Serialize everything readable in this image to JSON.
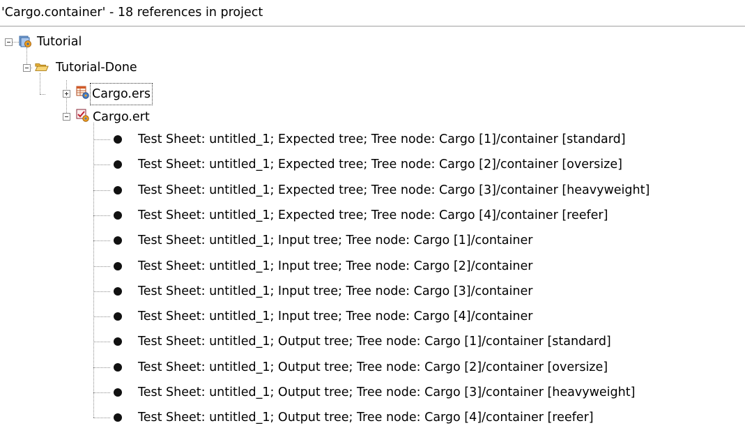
{
  "header": {
    "title": "'Cargo.container' - 18 references in project"
  },
  "tree": {
    "root": {
      "label": "Tutorial",
      "icon": "project-icon",
      "state": "expanded"
    },
    "folder": {
      "label": "Tutorial-Done",
      "icon": "open-folder-icon",
      "state": "expanded"
    },
    "files": [
      {
        "label": "Cargo.ers",
        "icon": "ers-file-icon",
        "state": "collapsed",
        "selected": true
      },
      {
        "label": "Cargo.ert",
        "icon": "ert-file-icon",
        "state": "expanded",
        "selected": false
      }
    ],
    "references": [
      "Test Sheet: untitled_1; Expected tree; Tree node: Cargo [1]/container [standard]",
      "Test Sheet: untitled_1; Expected tree; Tree node: Cargo [2]/container [oversize]",
      "Test Sheet: untitled_1; Expected tree; Tree node: Cargo [3]/container [heavyweight]",
      "Test Sheet: untitled_1; Expected tree; Tree node: Cargo [4]/container [reefer]",
      "Test Sheet: untitled_1; Input tree; Tree node: Cargo [1]/container",
      "Test Sheet: untitled_1; Input tree; Tree node: Cargo [2]/container",
      "Test Sheet: untitled_1; Input tree; Tree node: Cargo [3]/container",
      "Test Sheet: untitled_1; Input tree; Tree node: Cargo [4]/container",
      "Test Sheet: untitled_1; Output tree; Tree node: Cargo [1]/container [standard]",
      "Test Sheet: untitled_1; Output tree; Tree node: Cargo [2]/container [oversize]",
      "Test Sheet: untitled_1; Output tree; Tree node: Cargo [3]/container [heavyweight]",
      "Test Sheet: untitled_1; Output tree; Tree node: Cargo [4]/container [reefer]"
    ],
    "reference_icon": "bullet-icon"
  }
}
